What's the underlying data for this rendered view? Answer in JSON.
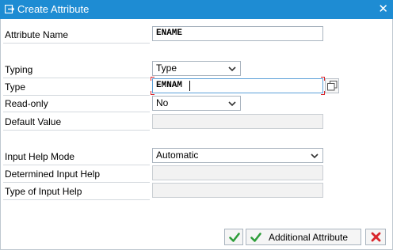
{
  "window": {
    "title": "Create Attribute",
    "close_icon": "close-icon",
    "title_icon": "create-attribute-icon",
    "titlebar_color": "#1e8cd3"
  },
  "form": {
    "attribute_name": {
      "label": "Attribute Name",
      "value": "ENAME"
    },
    "typing": {
      "label": "Typing",
      "value": "Type"
    },
    "type": {
      "label": "Type",
      "value": "EMNAM"
    },
    "read_only": {
      "label": "Read-only",
      "value": "No"
    },
    "default_value": {
      "label": "Default Value",
      "value": ""
    },
    "input_help_mode": {
      "label": "Input Help Mode",
      "value": "Automatic"
    },
    "determined_input_help": {
      "label": "Determined Input Help",
      "value": ""
    },
    "type_of_input_help": {
      "label": "Type of Input Help",
      "value": ""
    }
  },
  "footer": {
    "confirm_icon": "checkmark-icon",
    "additional_attribute_label": "Additional Attribute",
    "cancel_icon": "cancel-x-icon",
    "confirm_color": "#2e9e3a",
    "cancel_color": "#d9262c"
  }
}
